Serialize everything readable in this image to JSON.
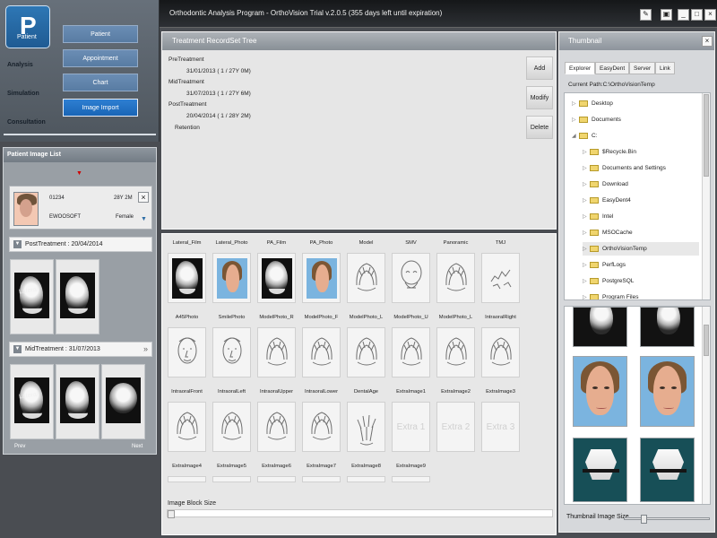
{
  "app": {
    "title": "Orthodontic Analysis Program - OrthoVision Trial v.2.0.5 (355 days left until expiration)",
    "window_controls": [
      "",
      "",
      "_",
      "□",
      "×"
    ]
  },
  "left_nav": {
    "patient_tab": {
      "letter": "P",
      "label": "Patient"
    },
    "sections": [
      "Analysis",
      "Simulation",
      "Consultation"
    ],
    "buttons": [
      "Patient",
      "Appointment",
      "Chart",
      "Image Import"
    ]
  },
  "patient_image_list": {
    "title": "Patient Image List",
    "patient": {
      "id": "01234",
      "age": "28Y 2M",
      "name": "EWOOSOFT",
      "gender": "Female"
    },
    "post_treatment_label": "PostTreatment : 20/04/2014",
    "mid_treatment_label": "MidTreatment : 31/07/2013",
    "thumb_label": "Lateral",
    "prev": "Prev",
    "next": "Next"
  },
  "treatment_tree": {
    "title": "Treatment RecordSet Tree",
    "items": [
      "PreTreatment",
      "31/01/2013 ( 1 / 27Y 0M)",
      "MidTreatment",
      "31/07/2013 ( 1 / 27Y 6M)",
      "PostTreatment",
      "20/04/2014 ( 1 / 28Y 2M)",
      "Retention"
    ],
    "buttons": [
      "Add",
      "Modify",
      "Delete"
    ]
  },
  "image_grid": {
    "labels": [
      "Lateral_Film",
      "Lateral_Photo",
      "PA_Film",
      "PA_Photo",
      "Model",
      "SMV",
      "Panoramic",
      "TMJ",
      "A45Photo",
      "SmilePhoto",
      "ModelPhoto_R",
      "ModelPhoto_F",
      "ModelPhoto_L",
      "ModelPhoto_U",
      "ModelPhoto_L",
      "IntraoralRight",
      "IntraoralFront",
      "IntraoralLeft",
      "IntraoralUpper",
      "IntraoralLower",
      "DentalAge",
      "ExtraImage1",
      "ExtraImage2",
      "ExtraImage3",
      "ExtraImage4",
      "ExtraImage5",
      "ExtraImage6",
      "ExtraImage7",
      "ExtraImage8",
      "ExtraImage9"
    ],
    "extra_labels": [
      "Extra 1",
      "Extra 2",
      "Extra 3"
    ],
    "image_block_size_label": "Image Block Size"
  },
  "thumbnail": {
    "title": "Thumbnail",
    "tabs": [
      "Explorer",
      "EasyDent",
      "Server",
      "Link"
    ],
    "current_path": "Current Path:C:\\OrthoVisionTemp",
    "folders": [
      "Desktop",
      "Documents",
      "C:",
      "$Recycle.Bin",
      "Documents and Settings",
      "Download",
      "EasyDent4",
      "Intel",
      "MSOCache",
      "OrthoVisionTemp",
      "PerfLogs",
      "PostgreSQL",
      "Program Files"
    ],
    "slider_label": "Thumbnail Image Size"
  }
}
